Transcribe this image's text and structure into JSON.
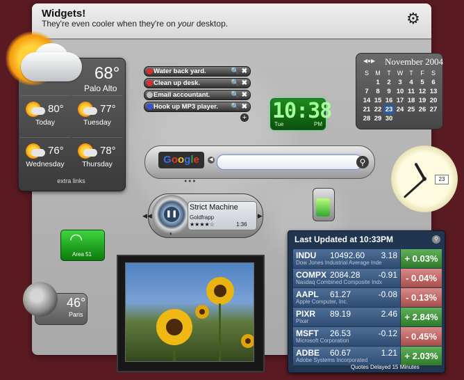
{
  "header": {
    "title": "Widgets!",
    "subtitle_pre": "They're even cooler when they're on ",
    "subtitle_em": "your",
    "subtitle_post": " desktop."
  },
  "weather": {
    "temp": "68°",
    "city": "Palo Alto",
    "days": [
      {
        "name": "Today",
        "temp": "80°"
      },
      {
        "name": "Tuesday",
        "temp": "77°"
      },
      {
        "name": "Wednesday",
        "temp": "76°"
      },
      {
        "name": "Thursday",
        "temp": "78°"
      }
    ],
    "extra": "extra links"
  },
  "todos": [
    {
      "text": "Water back yard.",
      "color": "#d63030"
    },
    {
      "text": "Clean up desk.",
      "color": "#d63030"
    },
    {
      "text": "Email accountant.",
      "color": "#bdbdbd"
    },
    {
      "text": "Hook up MP3 player.",
      "color": "#3a4fd8"
    }
  ],
  "digital_clock": {
    "time": "10:38",
    "day": "Tue",
    "ampm": "PM"
  },
  "calendar": {
    "month": "November 2004",
    "headers": [
      "S",
      "M",
      "T",
      "W",
      "T",
      "F",
      "S"
    ],
    "weeks": [
      [
        "",
        "1",
        "2",
        "3",
        "4",
        "5",
        "6"
      ],
      [
        "7",
        "8",
        "9",
        "10",
        "11",
        "12",
        "13"
      ],
      [
        "14",
        "15",
        "16",
        "17",
        "18",
        "19",
        "20"
      ],
      [
        "21",
        "22",
        "23",
        "24",
        "25",
        "26",
        "27"
      ],
      [
        "28",
        "29",
        "30",
        "",
        "",
        "",
        ""
      ]
    ],
    "today": "23"
  },
  "analog_clock": {
    "date": "23"
  },
  "google": {
    "logo": [
      "G",
      "o",
      "o",
      "g",
      "l",
      "e"
    ],
    "query": ""
  },
  "itunes": {
    "title": "Strict Machine",
    "artist": "Goldfrapp",
    "stars": "★★★★☆",
    "time": "1:36"
  },
  "area51": {
    "label": "Area 51"
  },
  "moon_weather": {
    "temp": "46°",
    "city": "Paris"
  },
  "stocks": {
    "updated": "Last Updated at 10:33PM",
    "rows": [
      {
        "sym": "INDU",
        "price": "10492.60",
        "chg": "3.18",
        "name": "Dow Jones Industrial Average Inde",
        "pct": "+ 0.03%",
        "dir": "pos"
      },
      {
        "sym": "COMPX",
        "price": "2084.28",
        "chg": "-0.91",
        "name": "Nasdaq Combined Composite Indx",
        "pct": "- 0.04%",
        "dir": "neg"
      },
      {
        "sym": "AAPL",
        "price": "61.27",
        "chg": "-0.08",
        "name": "Apple Computer, Inc.",
        "pct": "- 0.13%",
        "dir": "neg"
      },
      {
        "sym": "PIXR",
        "price": "89.19",
        "chg": "2.46",
        "name": "Pixar",
        "pct": "+ 2.84%",
        "dir": "pos"
      },
      {
        "sym": "MSFT",
        "price": "26.53",
        "chg": "-0.12",
        "name": "Microsoft Corporation",
        "pct": "- 0.45%",
        "dir": "neg"
      },
      {
        "sym": "ADBE",
        "price": "60.67",
        "chg": "1.21",
        "name": "Adobe Systems Incorporated",
        "pct": "+ 2.03%",
        "dir": "pos"
      }
    ],
    "footer": "Quotes Delayed 15 Minutes"
  }
}
